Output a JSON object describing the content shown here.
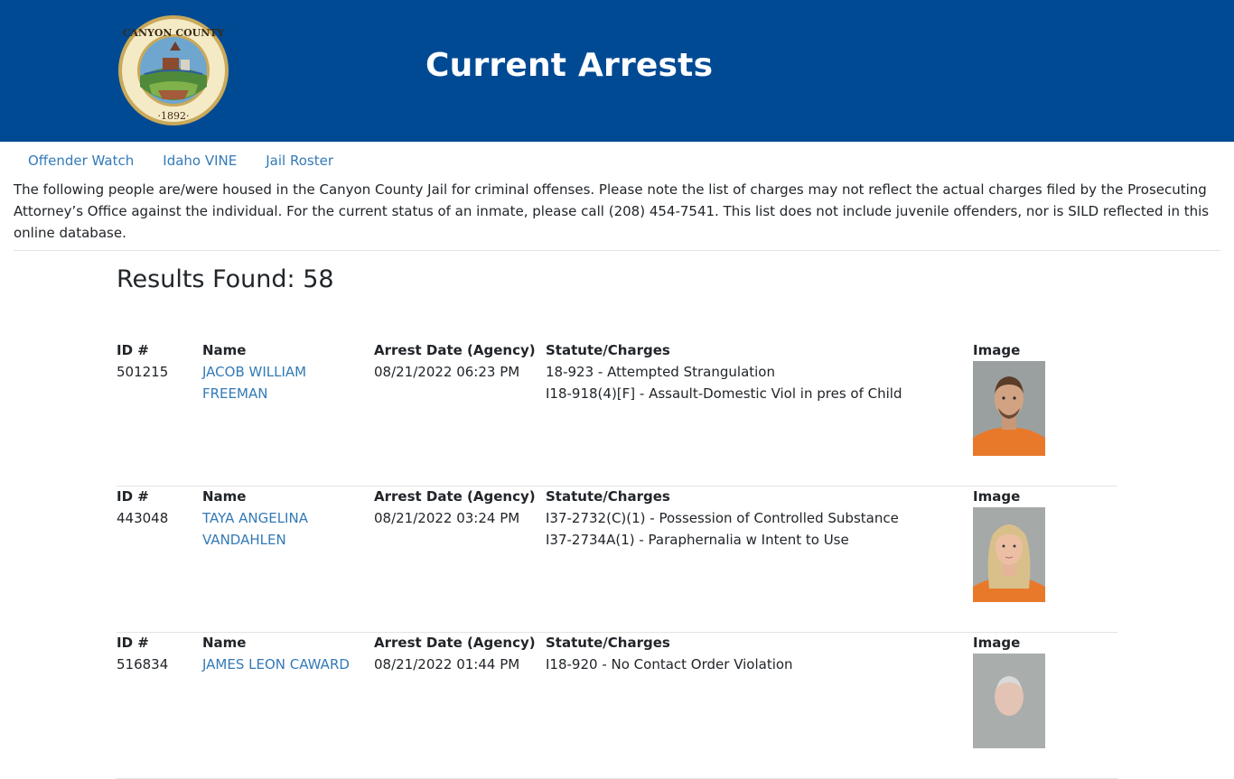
{
  "header": {
    "title": "Current Arrests",
    "seal_text": "CANYON COUNTY IDAHO",
    "seal_year": "1892"
  },
  "nav": {
    "items": [
      {
        "label": "Offender Watch"
      },
      {
        "label": "Idaho VINE"
      },
      {
        "label": "Jail Roster"
      }
    ]
  },
  "intro": "The following people are/were housed in the Canyon County Jail for criminal offenses. Please note the list of charges may not reflect the actual charges filed by the Prosecuting Attorney’s Office against the individual. For the current status of an inmate, please call (208) 454-7541. This list does not include juvenile offenders, nor is SILD reflected in this online database.",
  "results": {
    "label": "Results Found: 58"
  },
  "columns": {
    "id": "ID #",
    "name": "Name",
    "date": "Arrest Date (Agency)",
    "charges": "Statute/Charges",
    "image": "Image"
  },
  "records": [
    {
      "id": "501215",
      "name_line1": "JACOB WILLIAM",
      "name_line2": "FREEMAN",
      "date": "08/21/2022 06:23 PM",
      "charges": [
        "18-923 - Attempted Strangulation",
        "I18-918(4)[F] - Assault-Domestic Viol in pres of Child"
      ]
    },
    {
      "id": "443048",
      "name_line1": "TAYA ANGELINA",
      "name_line2": "VANDAHLEN",
      "date": "08/21/2022 03:24 PM",
      "charges": [
        "I37-2732(C)(1) - Possession of Controlled Substance",
        "I37-2734A(1) - Paraphernalia w Intent to Use"
      ]
    },
    {
      "id": "516834",
      "name_line1": "JAMES LEON CAWARD",
      "name_line2": "",
      "date": "08/21/2022 01:44 PM",
      "charges": [
        "I18-920 - No Contact Order Violation",
        ""
      ]
    }
  ],
  "colors": {
    "header_bg": "#004a94",
    "link": "#337ab7"
  }
}
